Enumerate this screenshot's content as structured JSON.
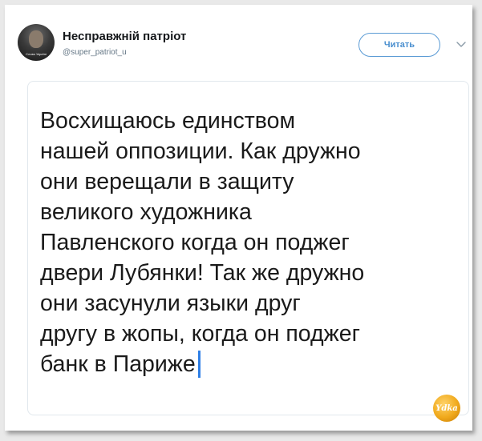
{
  "profile": {
    "display_name": "Несправжній патріот",
    "handle": "@super_patriot_u",
    "avatar_caption": "Слово Україні"
  },
  "actions": {
    "follow_label": "Читать",
    "more_icon": "chevron-down-icon"
  },
  "tweet": {
    "text": "Восхищаюсь единством\nнашей оппозиции. Как дружно\nони верещали в защиту\nвеликого художника\nПавленского когда он поджег\nдвери Лубянки! Так же дружно\nони засунули языки друг\nдругу в жопы, когда он поджег\nбанк в Париже"
  },
  "watermark": {
    "text": "Ydka"
  },
  "colors": {
    "accent": "#4a8fcf",
    "text": "#1a1a1a",
    "handle": "#657786",
    "cursor": "#2f7fe6",
    "badge": "#f0a91c"
  }
}
